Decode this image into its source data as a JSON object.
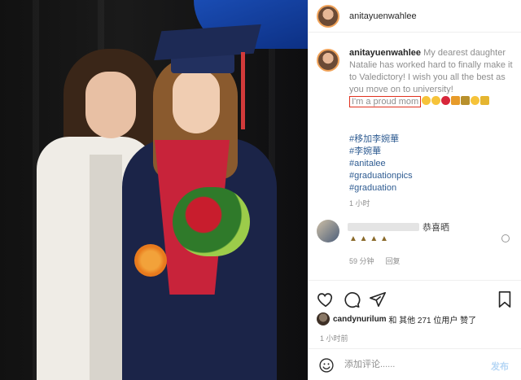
{
  "post": {
    "username": "anitayuenwahlee",
    "caption_text": "My dearest daughter Natalie has worked hard to finally make it to Valedictory! I wish you all the best as you move on to university!",
    "caption_highlight": "I'm a proud mom",
    "hashtags": [
      "#移加李婉華",
      "#李婉華",
      "#anitalee",
      "#graduationpics",
      "#graduation"
    ],
    "time": "1 小时"
  },
  "comment": {
    "text": "恭喜晒",
    "time": "59 分钟",
    "reply": "回复"
  },
  "likes": {
    "user": "candynurilum",
    "text": "和 其他 271 位用户 赞了"
  },
  "time_ago": "1 小时前",
  "add_comment": {
    "placeholder": "添加评论......",
    "post_label": "发布"
  },
  "colors": {
    "highlight_box": "#e0301e",
    "hashtag": "#2f5c92",
    "link_disabled": "#b5d6f5"
  }
}
